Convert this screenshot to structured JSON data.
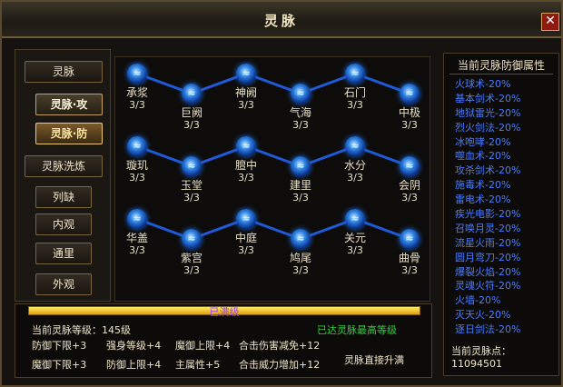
{
  "window": {
    "title": "灵脉"
  },
  "left_menu": {
    "items": [
      {
        "label": "灵脉",
        "style": "wide"
      },
      {
        "label": "灵脉·攻",
        "style": "tabbed"
      },
      {
        "label": "灵脉·防",
        "style": "tabbed active"
      },
      {
        "label": "灵脉洗炼",
        "style": "wide"
      },
      {
        "label": "列缺",
        "style": "narrow"
      },
      {
        "label": "内观",
        "style": "narrow"
      },
      {
        "label": "通里",
        "style": "narrow"
      },
      {
        "label": "外观",
        "style": "narrow"
      }
    ]
  },
  "graph": {
    "rows": [
      {
        "nodes": [
          {
            "name": "承浆",
            "count": "3/3"
          },
          {
            "name": "巨阙",
            "count": "3/3"
          },
          {
            "name": "神阙",
            "count": "3/3"
          },
          {
            "name": "气海",
            "count": "3/3"
          },
          {
            "name": "石门",
            "count": "3/3"
          },
          {
            "name": "中极",
            "count": "3/3"
          }
        ]
      },
      {
        "nodes": [
          {
            "name": "璇玑",
            "count": "3/3"
          },
          {
            "name": "玉堂",
            "count": "3/3"
          },
          {
            "name": "膻中",
            "count": "3/3"
          },
          {
            "name": "建里",
            "count": "3/3"
          },
          {
            "name": "水分",
            "count": "3/3"
          },
          {
            "name": "会阴",
            "count": "3/3"
          }
        ]
      },
      {
        "nodes": [
          {
            "name": "华盖",
            "count": "3/3"
          },
          {
            "name": "紫宫",
            "count": "3/3"
          },
          {
            "name": "中庭",
            "count": "3/3"
          },
          {
            "name": "鸠尾",
            "count": "3/3"
          },
          {
            "name": "关元",
            "count": "3/3"
          },
          {
            "name": "曲骨",
            "count": "3/3"
          }
        ]
      }
    ]
  },
  "right_panel": {
    "title": "当前灵脉防御属性",
    "defenses": [
      "火球术-20%",
      "基本剑术-20%",
      "地狱雷光-20%",
      "烈火剑法-20%",
      "冰咆哮-20%",
      "噬血术-20%",
      "攻杀剑术-20%",
      "施毒术-20%",
      "雷电术-20%",
      "疾光电影-20%",
      "召唤月灵-20%",
      "流星火雨-20%",
      "圆月弯刀-20%",
      "爆裂火焰-20%",
      "灵魂火符-20%",
      "火墙-20%",
      "灭天火-20%",
      "逐日剑法-20%"
    ],
    "points_label": "当前灵脉点：",
    "points_value": "11094501"
  },
  "bottom": {
    "bar_text": "已满级",
    "level_label": "当前灵脉等级：",
    "level_value": "145级",
    "max_text": "已达灵脉最高等级",
    "stats": [
      [
        "防御下限+3",
        "强身等级+4",
        "魔御上限+4",
        "合击伤害减免+12"
      ],
      [
        "魔御下限+3",
        "防御上限+4",
        "主属性+5",
        "合击威力增加+12"
      ]
    ],
    "upgrade_text": "灵脉直接升满"
  },
  "colors": {
    "node_glow": "#1a6ad8",
    "link": "#1f5ad8",
    "defense_text": "#4a7cff",
    "green": "#30d040"
  }
}
